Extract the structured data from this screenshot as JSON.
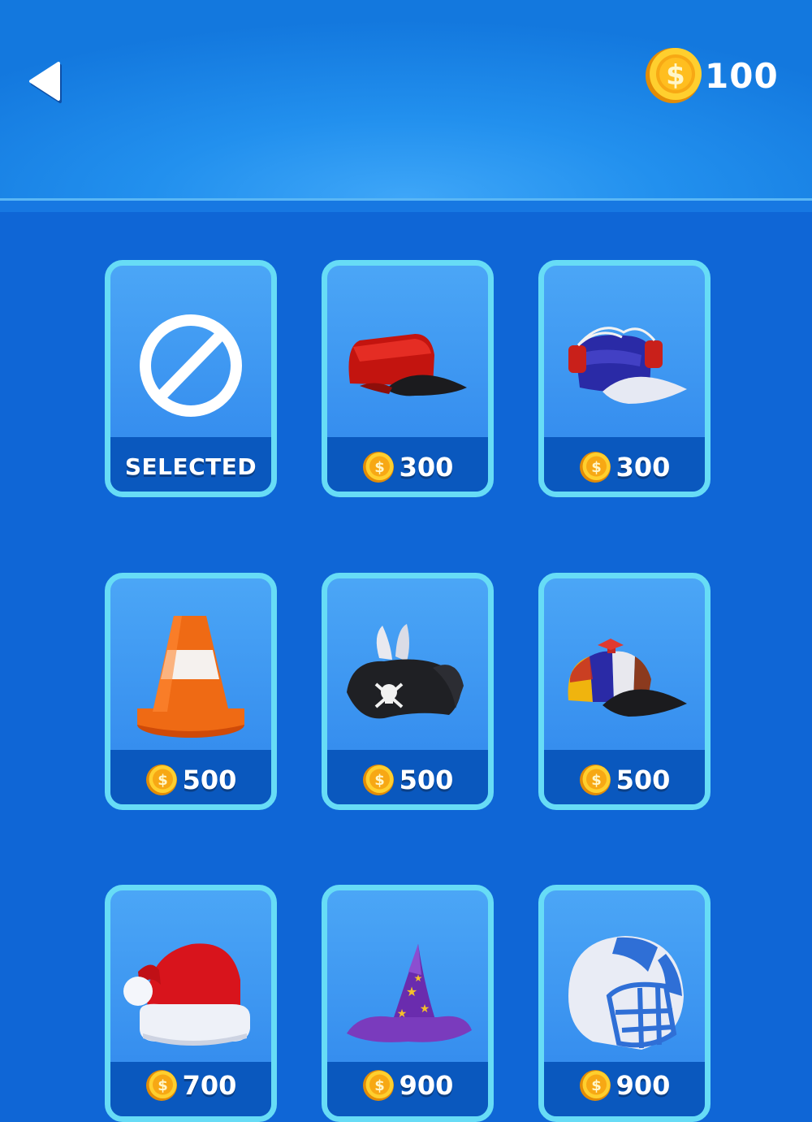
{
  "header": {
    "back_icon": "back-arrow-icon",
    "coin_balance": "100"
  },
  "items": [
    {
      "name": "none",
      "icon": "no-hat-icon",
      "status": "SELECTED"
    },
    {
      "name": "red-cap",
      "icon": "red-cap-icon",
      "price": "300"
    },
    {
      "name": "drink-helmet",
      "icon": "drink-helmet-icon",
      "price": "300"
    },
    {
      "name": "traffic-cone",
      "icon": "traffic-cone-icon",
      "price": "500"
    },
    {
      "name": "pirate-hat",
      "icon": "pirate-hat-icon",
      "price": "500"
    },
    {
      "name": "propeller-cap",
      "icon": "propeller-cap-icon",
      "price": "500"
    },
    {
      "name": "santa-hat",
      "icon": "santa-hat-icon",
      "price": "700"
    },
    {
      "name": "wizard-hat",
      "icon": "wizard-hat-icon",
      "price": "900"
    },
    {
      "name": "football-helmet",
      "icon": "football-helmet-icon",
      "price": "900"
    }
  ],
  "colors": {
    "background": "#0f66d6",
    "card_border": "#67dcf6",
    "card_footer": "#0a58be",
    "coin": "#f5b315"
  }
}
